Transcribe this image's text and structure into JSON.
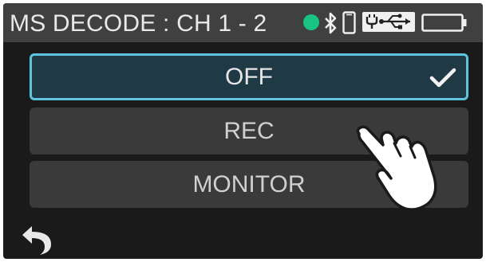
{
  "header": {
    "title": "MS DECODE : CH 1 - 2",
    "status_icons": [
      "status-dot-icon",
      "bluetooth-icon",
      "phone-icon",
      "usb-icon",
      "battery-icon"
    ],
    "status_dot_color": "#19c483"
  },
  "options": [
    {
      "label": "OFF",
      "selected": true
    },
    {
      "label": "REC",
      "selected": false
    },
    {
      "label": "MONITOR",
      "selected": false
    }
  ],
  "footer": {
    "back_icon": "back-arrow-icon"
  },
  "overlay": {
    "pointer_icon": "pointing-hand-icon"
  },
  "colors": {
    "selection_border": "#5dc3df",
    "selected_bg": "#1f3a44",
    "option_bg": "#3a3a3a",
    "header_bg": "#404040",
    "screen_bg": "#1a1a1a"
  }
}
